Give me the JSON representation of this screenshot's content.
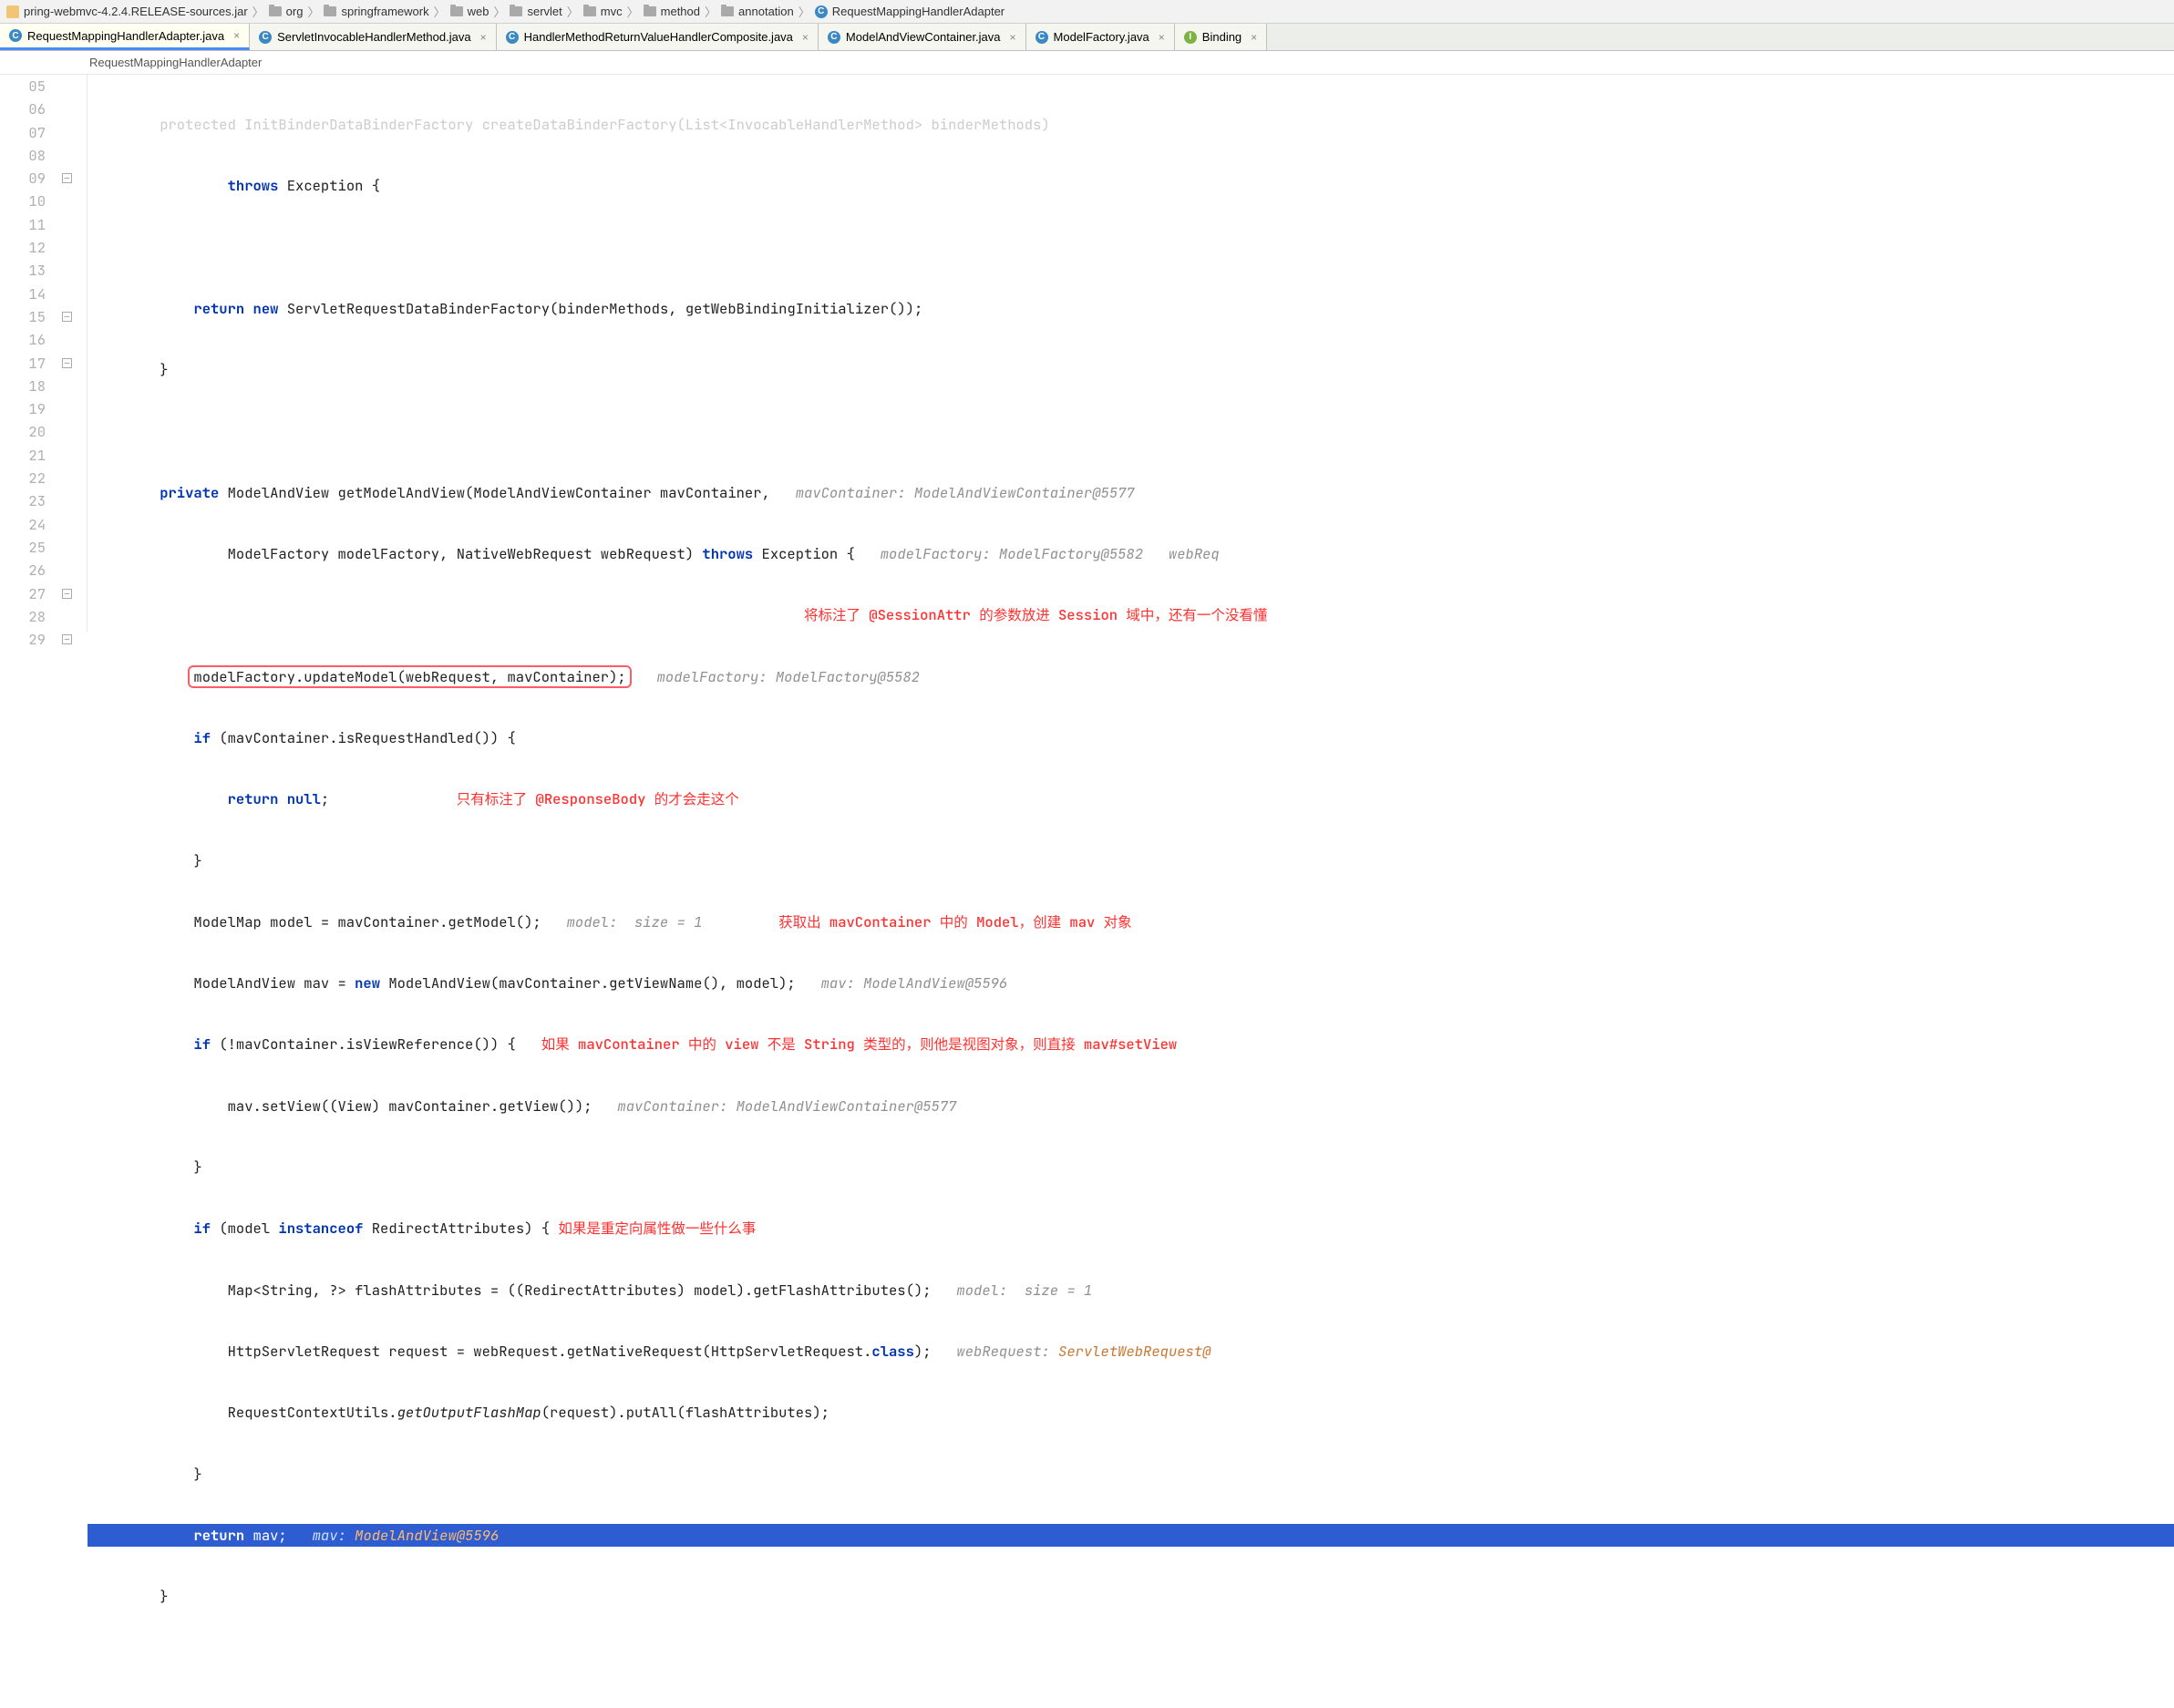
{
  "breadcrumbs": [
    {
      "icon": "jar",
      "label": "pring-webmvc-4.2.4.RELEASE-sources.jar"
    },
    {
      "icon": "folder",
      "label": "org"
    },
    {
      "icon": "folder",
      "label": "springframework"
    },
    {
      "icon": "folder",
      "label": "web"
    },
    {
      "icon": "folder",
      "label": "servlet"
    },
    {
      "icon": "folder",
      "label": "mvc"
    },
    {
      "icon": "folder",
      "label": "method"
    },
    {
      "icon": "folder",
      "label": "annotation"
    },
    {
      "icon": "class",
      "label": "RequestMappingHandlerAdapter"
    }
  ],
  "tabs": [
    {
      "icon": "class",
      "label": "RequestMappingHandlerAdapter.java",
      "active": true
    },
    {
      "icon": "class",
      "label": "ServletInvocableHandlerMethod.java"
    },
    {
      "icon": "class",
      "label": "HandlerMethodReturnValueHandlerComposite.java"
    },
    {
      "icon": "class",
      "label": "ModelAndViewContainer.java"
    },
    {
      "icon": "class",
      "label": "ModelFactory.java"
    },
    {
      "icon": "interface",
      "label": "Binding"
    }
  ],
  "context_bar": "RequestMappingHandlerAdapter",
  "gutter_start": 5,
  "gutter_lines": [
    "05",
    "06",
    "07",
    "08",
    "09",
    "10",
    "11",
    "12",
    "13",
    "14",
    "15",
    "16",
    "17",
    "18",
    "19",
    "20",
    "21",
    "22",
    "23",
    "24",
    "25",
    "26",
    "27",
    "28",
    "29"
  ],
  "override_symbol": "@",
  "override_row": 6,
  "fold_marks": [
    {
      "row": 4,
      "glyph": "—"
    },
    {
      "row": 10,
      "glyph": "—"
    },
    {
      "row": 12,
      "glyph": "—"
    },
    {
      "row": 22,
      "glyph": "—"
    },
    {
      "row": 24,
      "glyph": "—"
    }
  ],
  "code": {
    "l0_pre": "    protected InitBinderDataBinderFactory createDataBinderFactory(List<InvocableHandlerMethod> binderMethods)",
    "l1_kw": "throws",
    "l1_post": " Exception {",
    "l3_kw1": "return",
    "l3_kw2": "new",
    "l3_post": " ServletRequestDataBinderFactory(binderMethods, getWebBindingInitializer());",
    "l4": "    }",
    "l6_kw": "private",
    "l6_post": " ModelAndView getModelAndView(ModelAndViewContainer mavContainer,",
    "l6_hint": "   mavContainer: ModelAndViewContainer@5577",
    "l7_a": "            ModelFactory modelFactory, NativeWebRequest webRequest) ",
    "l7_kw": "throws",
    "l7_b": " Exception {",
    "l7_hint": "   modelFactory: ModelFactory@5582   webReq",
    "l8_note": "                                                                                将标注了 @SessionAttr 的参数放进 Session 域中，还有一个没看懂",
    "l9_box": "modelFactory.updateModel(webRequest, mavContainer);",
    "l9_hint": "   modelFactory: ModelFactory@5582",
    "l10_kw": "if",
    "l10_a": " (mavContainer.isRequestHandled()) {",
    "l11_kw": "return null",
    "l11_semi": ";",
    "l11_note": "               只有标注了 @ResponseBody 的才会走这个",
    "l12": "        }",
    "l13_a": "        ModelMap model = mavContainer.getModel();",
    "l13_hint": "   model:  size = 1",
    "l13_note": "         获取出 mavContainer 中的 Model，创建 mav 对象",
    "l14_a": "        ModelAndView mav = ",
    "l14_kw": "new",
    "l14_b": " ModelAndView(mavContainer.getViewName(), model);",
    "l14_hint": "   mav: ModelAndView@5596",
    "l15_kw": "if",
    "l15_a": " (!mavContainer.isViewReference()) {",
    "l15_note": "   如果 mavContainer 中的 view 不是 String 类型的，则他是视图对象，则直接 mav#setView",
    "l16_a": "            mav.setView((View) mavContainer.getView());",
    "l16_hint": "   mavContainer: ModelAndViewContainer@5577",
    "l17": "        }",
    "l18_kw": "if",
    "l18_a": " (model ",
    "l18_kw2": "instanceof",
    "l18_b": " RedirectAttributes) {",
    "l18_note": " 如果是重定向属性做一些什么事",
    "l19_a": "            Map<String, ?> flashAttributes = ((RedirectAttributes) model).getFlashAttributes();",
    "l19_hint": "   model:  size = 1",
    "l20_a": "            HttpServletRequest request = webRequest.getNativeRequest(HttpServletRequest.",
    "l20_kw": "class",
    "l20_b": ");",
    "l20_hint": "   webRequest: ",
    "l20_hint2": "ServletWebRequest@",
    "l21_a": "            RequestContextUtils.",
    "l21_it": "getOutputFlashMap",
    "l21_b": "(request).putAll(flashAttributes);",
    "l22": "        }",
    "l23_kw": "return",
    "l23_a": " mav;",
    "l23_hint": "   mav: ",
    "l23_hint2": "ModelAndView@5596",
    "l24": "    }"
  }
}
